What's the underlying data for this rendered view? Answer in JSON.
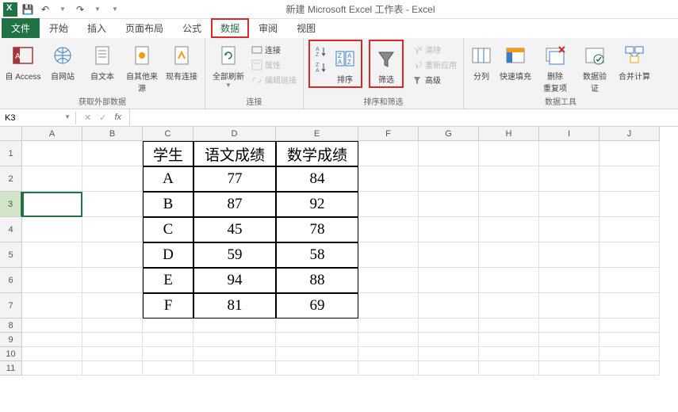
{
  "title": "新建 Microsoft Excel 工作表 - Excel",
  "qat": {
    "save": "💾",
    "undo": "↶",
    "redo": "↷"
  },
  "tabs": {
    "file": "文件",
    "home": "开始",
    "insert": "插入",
    "layout": "页面布局",
    "formula": "公式",
    "data": "数据",
    "review": "审阅",
    "view": "视图"
  },
  "ribbon": {
    "external": {
      "access": "自 Access",
      "web": "自网站",
      "text": "自文本",
      "other": "自其他来源",
      "existing": "现有连接",
      "label": "获取外部数据"
    },
    "conn": {
      "refresh": "全部刷新",
      "connect": "连接",
      "prop": "属性",
      "editlink": "编辑链接",
      "label": "连接"
    },
    "sort": {
      "sort": "排序",
      "filter": "筛选",
      "clear": "清除",
      "reapply": "重新应用",
      "adv": "高级",
      "label": "排序和筛选"
    },
    "tools": {
      "split": "分列",
      "flash": "快速填充",
      "dup": "删除\n重复项",
      "valid": "数据验\n证",
      "merge": "合并计算",
      "label": "数据工具"
    }
  },
  "namebox": "K3",
  "fx_btns": {
    "cancel": "✕",
    "ok": "✓",
    "fx": "fx"
  },
  "columns": [
    "A",
    "B",
    "C",
    "D",
    "E",
    "F",
    "G",
    "H",
    "I",
    "J"
  ],
  "table": {
    "headers": [
      "学生",
      "语文成绩",
      "数学成绩"
    ],
    "rows": [
      [
        "A",
        "77",
        "84"
      ],
      [
        "B",
        "87",
        "92"
      ],
      [
        "C",
        "45",
        "78"
      ],
      [
        "D",
        "59",
        "58"
      ],
      [
        "E",
        "94",
        "88"
      ],
      [
        "F",
        "81",
        "69"
      ]
    ]
  }
}
